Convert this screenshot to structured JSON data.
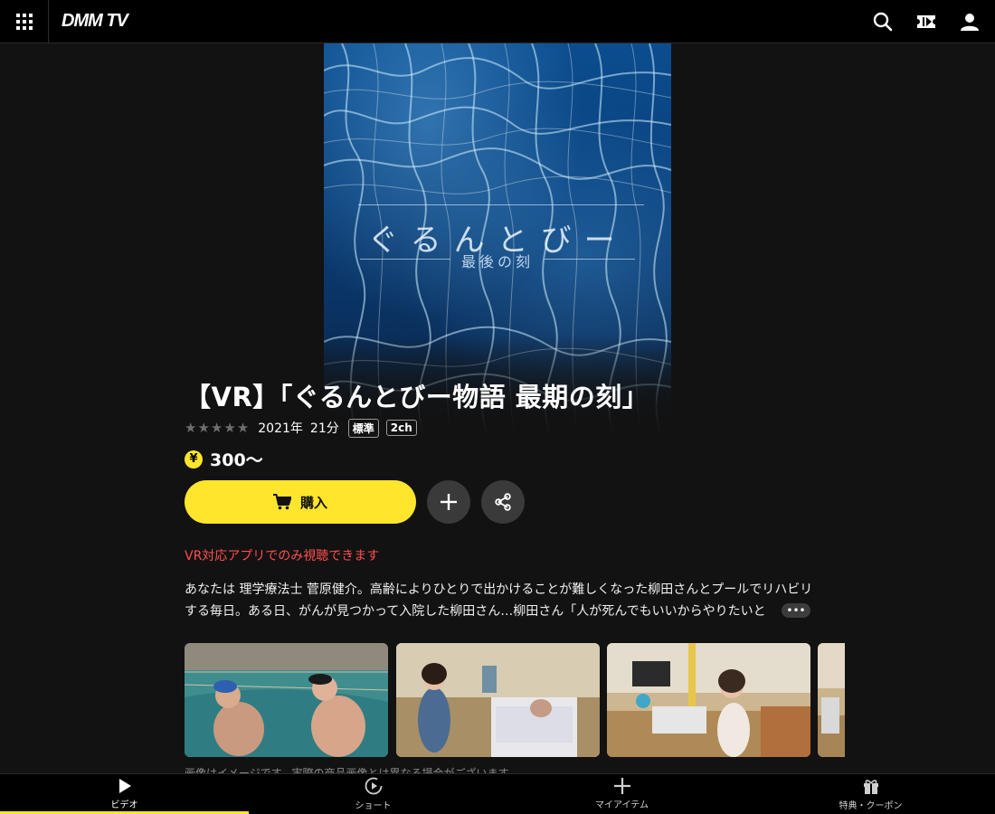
{
  "header": {
    "logo": "DMM TV",
    "icons": [
      "grid-menu-icon",
      "search-icon",
      "ticket-icon",
      "user-icon"
    ]
  },
  "poster": {
    "title": "ぐるんとびー",
    "subtitle": "最後の刻"
  },
  "detail": {
    "title": "【VR】「ぐるんとびー物語 最期の刻」",
    "rating_stars": 5,
    "rating_filled": 0,
    "year": "2021年",
    "duration": "21分",
    "tags": [
      "標準",
      "2ch"
    ],
    "price_symbol": "¥",
    "price": "300〜",
    "buy_label": "購入",
    "vr_note": "VR対応アプリでのみ視聴できます",
    "description": "あなたは 理学療法士 菅原健介。高齢によりひとりで出かけることが難しくなった柳田さんとプールでリハビリする毎日。ある日、がんが見つかって入院した柳田さん…柳田さん「人が死んでもいいからやりたいと",
    "more_label": "•••",
    "image_note": "画像はイメージです。実際の商品画像とは異なる場合がございます。"
  },
  "thumbnails": [
    {
      "scene": "pool"
    },
    {
      "scene": "hospital"
    },
    {
      "scene": "living-room"
    },
    {
      "scene": "partial"
    }
  ],
  "bottom_nav": [
    {
      "label": "ビデオ",
      "icon": "play-icon",
      "active": true
    },
    {
      "label": "ショート",
      "icon": "short-play-icon",
      "active": false
    },
    {
      "label": "マイアイテム",
      "icon": "plus-icon",
      "active": false
    },
    {
      "label": "特典・クーポン",
      "icon": "gift-icon",
      "active": false
    }
  ],
  "colors": {
    "accent": "#ffe52b",
    "background": "#121212",
    "warning": "#ff4d4d"
  }
}
